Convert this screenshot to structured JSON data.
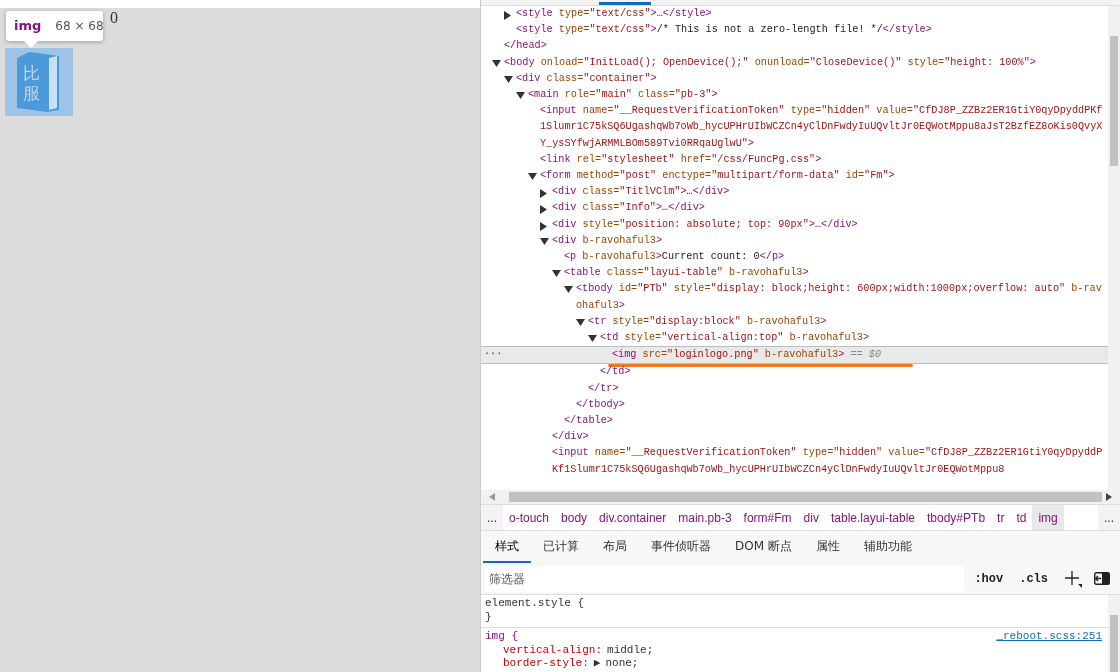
{
  "page": {
    "count_text": "0",
    "tooltip": {
      "tag": "img",
      "size": "68 × 68"
    },
    "logo_text": "比服"
  },
  "elements": {
    "row_menu": "...",
    "nodes": [
      {
        "selected": false,
        "children": [
          {
            "selected": false,
            "expanded": false,
            "open": [
              {
                "kind": "tag",
                "text": "<style"
              },
              {
                "kind": "attr",
                "text": " type="
              },
              {
                "kind": "val",
                "text": "\"text/css\""
              },
              {
                "kind": "tag",
                "text": ">"
              },
              {
                "kind": "text",
                "text": "…"
              },
              {
                "kind": "tag",
                "text": "</style>"
              }
            ]
          },
          {
            "selected": false,
            "open": [
              {
                "kind": "tag",
                "text": "<style"
              },
              {
                "kind": "attr",
                "text": " type="
              },
              {
                "kind": "val",
                "text": "\"text/css\""
              },
              {
                "kind": "tag",
                "text": ">"
              },
              {
                "kind": "text",
                "text": "/* This is not a zero-length file! */"
              },
              {
                "kind": "tag",
                "text": "</style>"
              }
            ]
          }
        ],
        "close": [
          {
            "kind": "tag",
            "text": "</head>"
          }
        ]
      },
      {
        "selected": false,
        "expanded": true,
        "open": [
          {
            "kind": "tag",
            "text": "<body"
          },
          {
            "kind": "attr",
            "text": " onload="
          },
          {
            "kind": "val",
            "text": "\"InitLoad(); OpenDevice();\""
          },
          {
            "kind": "attr",
            "text": " onunload="
          },
          {
            "kind": "val",
            "text": "\"CloseDevice()\""
          },
          {
            "kind": "attr",
            "text": " style="
          },
          {
            "kind": "val",
            "text": "\"height: 100%\""
          },
          {
            "kind": "tag",
            "text": ">"
          }
        ],
        "children": [
          {
            "selected": false,
            "expanded": true,
            "open": [
              {
                "kind": "tag",
                "text": "<div"
              },
              {
                "kind": "attr",
                "text": " class="
              },
              {
                "kind": "val",
                "text": "\"container\""
              },
              {
                "kind": "tag",
                "text": ">"
              }
            ],
            "children": [
              {
                "selected": false,
                "expanded": true,
                "open": [
                  {
                    "kind": "tag",
                    "text": "<main"
                  },
                  {
                    "kind": "attr",
                    "text": " role="
                  },
                  {
                    "kind": "val",
                    "text": "\"main\""
                  },
                  {
                    "kind": "attr",
                    "text": " class="
                  },
                  {
                    "kind": "val",
                    "text": "\"pb-3\""
                  },
                  {
                    "kind": "tag",
                    "text": ">"
                  }
                ],
                "children": [
                  {
                    "selected": false,
                    "open": [
                      {
                        "kind": "tag",
                        "text": "<input"
                      },
                      {
                        "kind": "attr",
                        "text": " name="
                      },
                      {
                        "kind": "val",
                        "text": "\"__RequestVerificationToken\""
                      },
                      {
                        "kind": "attr",
                        "text": " type="
                      },
                      {
                        "kind": "val",
                        "text": "\"hidden\""
                      },
                      {
                        "kind": "attr",
                        "text": " value="
                      },
                      {
                        "kind": "val",
                        "text": "\"CfDJ8P_ZZBz2ER1GtiY0qyDpyddPKf1Slumr1C75kSQ6UgashqWb7oWb_hycUPHrUIbWCZCn4yClDnFwdyIuUQvltJr0EQWotMppu8aJsT2BzfEZ8oKis0QvyXY_ysSYfwjARMMLBOm589Tvi0RRqaUglwU\""
                      },
                      {
                        "kind": "tag",
                        "text": ">"
                      }
                    ]
                  },
                  {
                    "selected": false,
                    "open": [
                      {
                        "kind": "tag",
                        "text": "<link"
                      },
                      {
                        "kind": "attr",
                        "text": " rel="
                      },
                      {
                        "kind": "val",
                        "text": "\"stylesheet\""
                      },
                      {
                        "kind": "attr",
                        "text": " href="
                      },
                      {
                        "kind": "val",
                        "text": "\"/css/FuncPg.css\""
                      },
                      {
                        "kind": "tag",
                        "text": ">"
                      }
                    ]
                  },
                  {
                    "selected": false,
                    "expanded": true,
                    "open": [
                      {
                        "kind": "tag",
                        "text": "<form"
                      },
                      {
                        "kind": "attr",
                        "text": " method="
                      },
                      {
                        "kind": "val",
                        "text": "\"post\""
                      },
                      {
                        "kind": "attr",
                        "text": " enctype="
                      },
                      {
                        "kind": "val",
                        "text": "\"multipart/form-data\""
                      },
                      {
                        "kind": "attr",
                        "text": " id="
                      },
                      {
                        "kind": "val",
                        "text": "\"Fm\""
                      },
                      {
                        "kind": "tag",
                        "text": ">"
                      }
                    ],
                    "children": [
                      {
                        "selected": false,
                        "expanded": false,
                        "open": [
                          {
                            "kind": "tag",
                            "text": "<div"
                          },
                          {
                            "kind": "attr",
                            "text": " class="
                          },
                          {
                            "kind": "val",
                            "text": "\"TitlVClm\""
                          },
                          {
                            "kind": "tag",
                            "text": ">"
                          },
                          {
                            "kind": "text",
                            "text": "…"
                          },
                          {
                            "kind": "tag",
                            "text": "</div>"
                          }
                        ]
                      },
                      {
                        "selected": false,
                        "expanded": false,
                        "open": [
                          {
                            "kind": "tag",
                            "text": "<div"
                          },
                          {
                            "kind": "attr",
                            "text": " class="
                          },
                          {
                            "kind": "val",
                            "text": "\"Info\""
                          },
                          {
                            "kind": "tag",
                            "text": ">"
                          },
                          {
                            "kind": "text",
                            "text": "…"
                          },
                          {
                            "kind": "tag",
                            "text": "</div>"
                          }
                        ]
                      },
                      {
                        "selected": false,
                        "expanded": false,
                        "open": [
                          {
                            "kind": "tag",
                            "text": "<div"
                          },
                          {
                            "kind": "attr",
                            "text": " style="
                          },
                          {
                            "kind": "val",
                            "text": "\"position: absolute; top: 90px\""
                          },
                          {
                            "kind": "tag",
                            "text": ">"
                          },
                          {
                            "kind": "text",
                            "text": "…"
                          },
                          {
                            "kind": "tag",
                            "text": "</div>"
                          }
                        ]
                      },
                      {
                        "selected": false,
                        "expanded": true,
                        "open": [
                          {
                            "kind": "tag",
                            "text": "<div"
                          },
                          {
                            "kind": "attr",
                            "text": " b-ravohaful3"
                          },
                          {
                            "kind": "tag",
                            "text": ">"
                          }
                        ],
                        "children": [
                          {
                            "selected": false,
                            "open": [
                              {
                                "kind": "tag",
                                "text": "<p"
                              },
                              {
                                "kind": "attr",
                                "text": " b-ravohaful3"
                              },
                              {
                                "kind": "tag",
                                "text": ">"
                              },
                              {
                                "kind": "text",
                                "text": "Current count: 0"
                              },
                              {
                                "kind": "tag",
                                "text": "</p>"
                              }
                            ]
                          },
                          {
                            "selected": false,
                            "expanded": true,
                            "open": [
                              {
                                "kind": "tag",
                                "text": "<table"
                              },
                              {
                                "kind": "attr",
                                "text": " class="
                              },
                              {
                                "kind": "val",
                                "text": "\"layui-table\""
                              },
                              {
                                "kind": "attr",
                                "text": " b-ravohaful3"
                              },
                              {
                                "kind": "tag",
                                "text": ">"
                              }
                            ],
                            "children": [
                              {
                                "selected": false,
                                "expanded": true,
                                "open": [
                                  {
                                    "kind": "tag",
                                    "text": "<tbody"
                                  },
                                  {
                                    "kind": "attr",
                                    "text": " id="
                                  },
                                  {
                                    "kind": "val",
                                    "text": "\"PTb\""
                                  },
                                  {
                                    "kind": "attr",
                                    "text": " style="
                                  },
                                  {
                                    "kind": "val",
                                    "text": "\"display: block;height: 600px;width:1000px;overflow: auto\""
                                  },
                                  {
                                    "kind": "attr",
                                    "text": " b-ravohaful3"
                                  },
                                  {
                                    "kind": "tag",
                                    "text": ">"
                                  }
                                ],
                                "children": [
                                  {
                                    "selected": false,
                                    "expanded": true,
                                    "open": [
                                      {
                                        "kind": "tag",
                                        "text": "<tr"
                                      },
                                      {
                                        "kind": "attr",
                                        "text": " style="
                                      },
                                      {
                                        "kind": "val",
                                        "text": "\"display:block\""
                                      },
                                      {
                                        "kind": "attr",
                                        "text": " b-ravohaful3"
                                      },
                                      {
                                        "kind": "tag",
                                        "text": ">"
                                      }
                                    ],
                                    "children": [
                                      {
                                        "selected": false,
                                        "expanded": true,
                                        "open": [
                                          {
                                            "kind": "tag",
                                            "text": "<td"
                                          },
                                          {
                                            "kind": "attr",
                                            "text": " style="
                                          },
                                          {
                                            "kind": "val",
                                            "text": "\"vertical-align:top\""
                                          },
                                          {
                                            "kind": "attr",
                                            "text": " b-ravohaful3"
                                          },
                                          {
                                            "kind": "tag",
                                            "text": ">"
                                          }
                                        ],
                                        "children": [
                                          {
                                            "selected": true,
                                            "open": [
                                              {
                                                "kind": "tag",
                                                "text": "<img"
                                              },
                                              {
                                                "kind": "attr",
                                                "text": " src="
                                              },
                                              {
                                                "kind": "val",
                                                "text": "\"loginlogo.png\""
                                              },
                                              {
                                                "kind": "attr",
                                                "text": " b-ravohaful3"
                                              },
                                              {
                                                "kind": "tag",
                                                "text": ">"
                                              },
                                              {
                                                "kind": "ref",
                                                "text": " == $0"
                                              }
                                            ]
                                          }
                                        ],
                                        "close": [
                                          {
                                            "kind": "tag",
                                            "text": "</td>"
                                          }
                                        ]
                                      }
                                    ],
                                    "close": [
                                      {
                                        "kind": "tag",
                                        "text": "</tr>"
                                      }
                                    ]
                                  }
                                ],
                                "close": [
                                  {
                                    "kind": "tag",
                                    "text": "</tbody>"
                                  }
                                ]
                              }
                            ],
                            "close": [
                              {
                                "kind": "tag",
                                "text": "</table>"
                              }
                            ]
                          }
                        ],
                        "close": [
                          {
                            "kind": "tag",
                            "text": "</div>"
                          }
                        ]
                      },
                      {
                        "selected": false,
                        "open": [
                          {
                            "kind": "tag",
                            "text": "<input"
                          },
                          {
                            "kind": "attr",
                            "text": " name="
                          },
                          {
                            "kind": "val",
                            "text": "\"__RequestVerificationToken\""
                          },
                          {
                            "kind": "attr",
                            "text": " type="
                          },
                          {
                            "kind": "val",
                            "text": "\"hidden\""
                          },
                          {
                            "kind": "attr",
                            "text": " value="
                          },
                          {
                            "kind": "val",
                            "text": "\"CfDJ8P_ZZBz2ER1GtiY0qyDpyddPKf1Slumr1C75kSQ6UgashqWb7oWb_hycUPHrUIbWCZCn4yClDnFwdyIuUQvltJr0EQWotMppu8"
                          }
                        ]
                      }
                    ]
                  }
                ]
              }
            ]
          }
        ]
      }
    ]
  },
  "breadcrumbs": {
    "scroll_left": "...",
    "scroll_right": "...",
    "items": [
      {
        "label": "o-touch",
        "selected": false
      },
      {
        "label": "body",
        "selected": false
      },
      {
        "label": "div.container",
        "selected": false
      },
      {
        "label": "main.pb-3",
        "selected": false
      },
      {
        "label": "form#Fm",
        "selected": false
      },
      {
        "label": "div",
        "selected": false
      },
      {
        "label": "table.layui-table",
        "selected": false
      },
      {
        "label": "tbody#PTb",
        "selected": false
      },
      {
        "label": "tr",
        "selected": false
      },
      {
        "label": "td",
        "selected": false
      },
      {
        "label": "img",
        "selected": true
      }
    ]
  },
  "tabs": [
    {
      "label": "样式",
      "selected": true
    },
    {
      "label": "已计算",
      "selected": false
    },
    {
      "label": "布局",
      "selected": false
    },
    {
      "label": "事件侦听器",
      "selected": false
    },
    {
      "label": "DOM 断点",
      "selected": false
    },
    {
      "label": "属性",
      "selected": false
    },
    {
      "label": "辅助功能",
      "selected": false
    }
  ],
  "filter": {
    "placeholder": "筛选器",
    "buttons": [
      ":hov",
      ".cls"
    ]
  },
  "rules": [
    {
      "selector": "element.style {",
      "close": "}"
    },
    {
      "selector": "img {",
      "source": "_reboot.scss:251",
      "declarations": [
        {
          "property": "vertical-align:",
          "value": "middle;"
        },
        {
          "property": "border-style:",
          "expander": "▶",
          "value": "none;"
        }
      ]
    }
  ]
}
